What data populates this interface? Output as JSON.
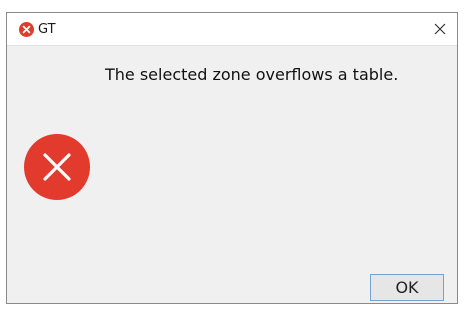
{
  "window": {
    "title": "GT",
    "title_icon": "error-icon",
    "close_glyph": "✕"
  },
  "dialog": {
    "message": "The selected zone overflows a table.",
    "icon": "error-icon",
    "ok_label": "OK"
  },
  "colors": {
    "error_red": "#e23b2e",
    "dialog_bg": "#f0f0f0",
    "button_border": "#7aa0cf"
  }
}
